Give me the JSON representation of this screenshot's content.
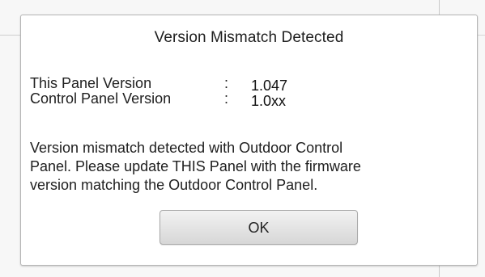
{
  "dialog": {
    "title": "Version Mismatch Detected",
    "rows": [
      {
        "label": "This Panel Version",
        "separator": ":",
        "value": "1.047"
      },
      {
        "label": "Control Panel Version",
        "separator": ":",
        "value": "1.0xx"
      }
    ],
    "message": "Version mismatch detected with Outdoor Control\nPanel. Please update THIS Panel with the firmware\nversion matching the Outdoor Control Panel.",
    "ok_label": "OK"
  },
  "colors": {
    "background": "#f3f3f3",
    "dialog_background": "#ffffff",
    "dialog_border": "#b5b5b5",
    "text": "#202020",
    "button_top": "#f2f2f2",
    "button_bottom": "#d7d7d7"
  }
}
